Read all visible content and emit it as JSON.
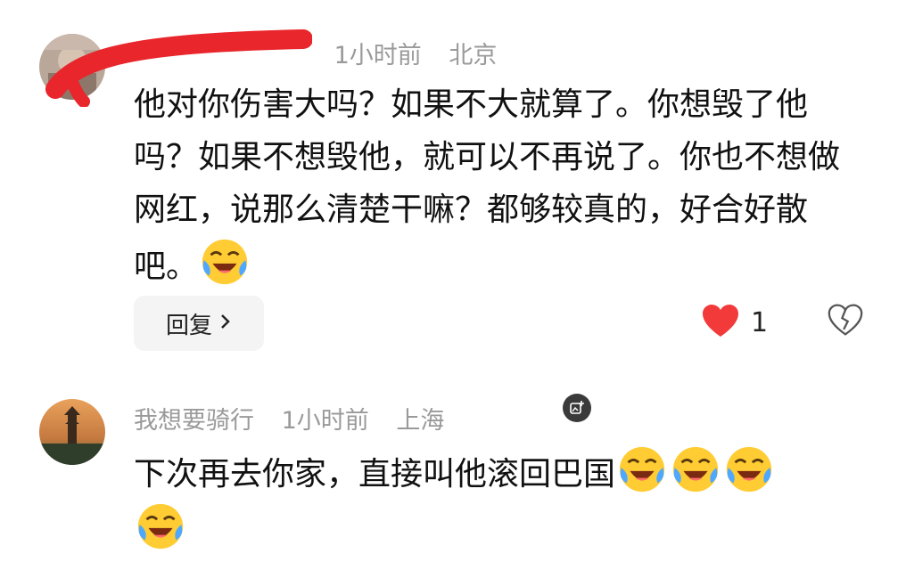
{
  "comments": [
    {
      "username": "",
      "time": "1小时前",
      "location": "北京",
      "text": "他对你伤害大吗？如果不大就算了。你想毁了他吗？如果不想毁他，就可以不再说了。你也不想做网红，说那么清楚干嘛？都够较真的，好合好散吧。",
      "emoji_count": 1,
      "emoji_icon": "laughing-crying-face-icon",
      "reply_label": "回复",
      "like_count": "1",
      "liked": true
    },
    {
      "username": "我想要骑行",
      "time": "1小时前",
      "location": "上海",
      "text": "下次再去你家，直接叫他滚回巴国",
      "emoji_count": 4,
      "emoji_icon": "laughing-crying-face-icon"
    }
  ],
  "colors": {
    "like_red": "#f23a3a",
    "meta_gray": "#9a9a9a",
    "redaction_red": "#e8262b"
  }
}
